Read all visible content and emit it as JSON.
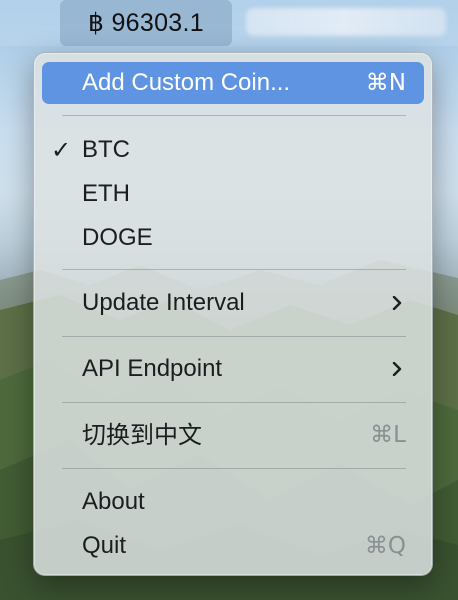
{
  "menubar": {
    "status_item_label": "฿ 96303.1"
  },
  "menu": {
    "add_custom_coin": {
      "label": "Add Custom Coin...",
      "shortcut": "⌘N"
    },
    "coins": [
      {
        "label": "BTC",
        "checked": true
      },
      {
        "label": "ETH",
        "checked": false
      },
      {
        "label": "DOGE",
        "checked": false
      }
    ],
    "checkmark": "✓",
    "update_interval": {
      "label": "Update Interval"
    },
    "api_endpoint": {
      "label": "API Endpoint"
    },
    "switch_language": {
      "label": "切换到中文",
      "shortcut": "⌘L"
    },
    "about": {
      "label": "About"
    },
    "quit": {
      "label": "Quit",
      "shortcut": "⌘Q"
    }
  },
  "colors": {
    "highlight": "#5f94e3",
    "shortcut_text": "#8b8f93",
    "menu_text": "#1d1d1f"
  },
  "icons": {
    "submenu": "chevron-right-icon",
    "selected": "checkmark-icon"
  }
}
